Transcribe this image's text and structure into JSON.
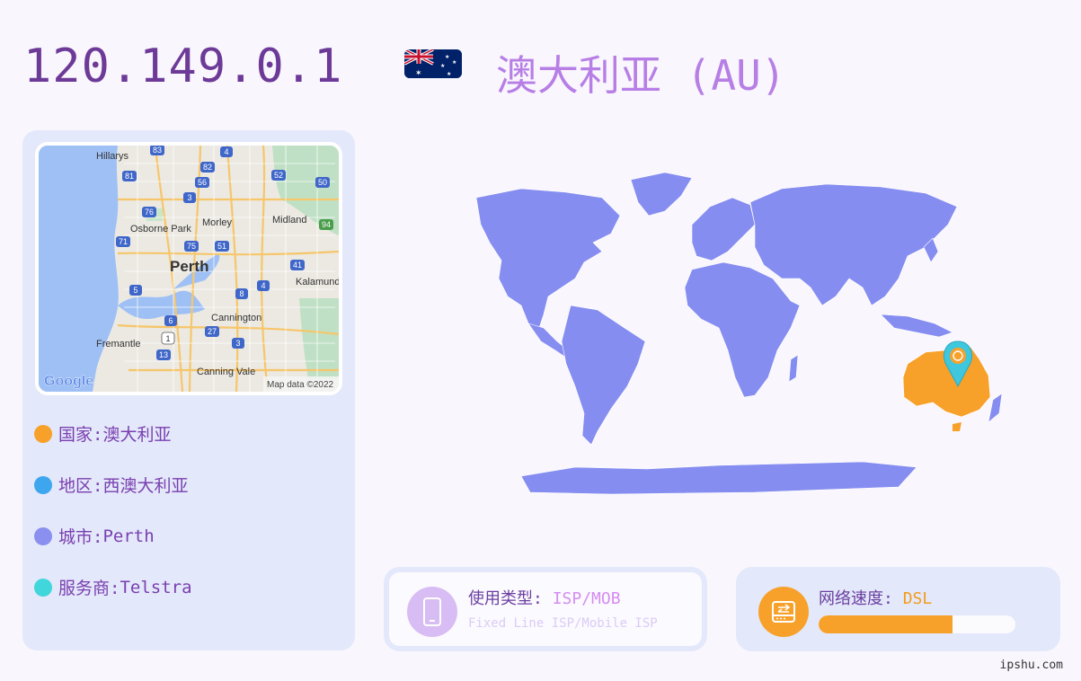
{
  "header": {
    "ip": "120.149.0.1",
    "country_title": "澳大利亚 (AU)"
  },
  "mini_map": {
    "places": [
      "Hillarys",
      "Morley",
      "Midland",
      "Osborne Park",
      "Perth",
      "Kalamunda",
      "Cannington",
      "Fremantle",
      "Canning Vale"
    ],
    "routes": [
      "83",
      "4",
      "81",
      "82",
      "52",
      "56",
      "50",
      "3",
      "76",
      "94",
      "71",
      "75",
      "51",
      "41",
      "5",
      "4",
      "8",
      "6",
      "27",
      "1",
      "3",
      "13"
    ],
    "brand": "Google",
    "attribution": "Map data ©2022"
  },
  "info": [
    {
      "label": "国家: ",
      "value": "澳大利亚",
      "color": "#f7a12a"
    },
    {
      "label": "地区: ",
      "value": "西澳大利亚",
      "color": "#3ea6ef"
    },
    {
      "label": "城市: ",
      "value": "Perth",
      "color": "#8a8ff0"
    },
    {
      "label": "服务商: ",
      "value": "Telstra",
      "color": "#3fd6dc"
    }
  ],
  "usage_card": {
    "label": "使用类型: ",
    "value": "ISP/MOB",
    "subtext": "Fixed Line ISP/Mobile ISP",
    "icon": "mobile-phone-icon"
  },
  "speed_card": {
    "label": "网络速度: ",
    "value": "DSL",
    "level": 0.68,
    "icon": "network-switch-icon"
  },
  "colors": {
    "world": "#868df0",
    "highlight": "#f7a12a",
    "pin": "#3fc7de",
    "accent_purple": "#6d3a98"
  },
  "footer": {
    "site": "ipshu.com"
  }
}
